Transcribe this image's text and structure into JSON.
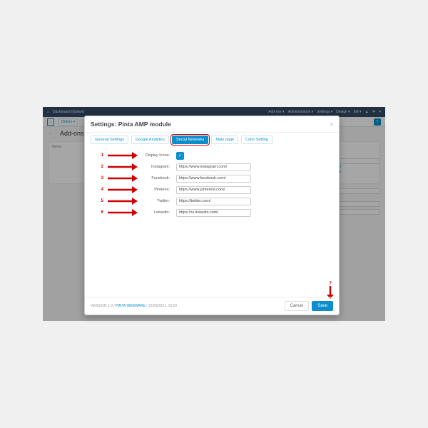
{
  "header": {
    "breadcrumb": "Dashboard (fastest)",
    "menu": {
      "addons": "Add-ons ▾",
      "admin": "Administration ▾",
      "settings": "Settings ▾",
      "design": "Design ▾",
      "lang": "EN ▾"
    }
  },
  "subheader": {
    "orders": "Orders ▾"
  },
  "page": {
    "back": "←",
    "title": "Add-ons"
  },
  "panel": {
    "name_col": "Name"
  },
  "sidebar": {
    "developers": "pers",
    "reload": "Reload",
    "odbase": "odbase"
  },
  "modal": {
    "title": "Settings: Pinta AMP module",
    "tabs": {
      "general": "General Settings",
      "analytics": "Google Analytics",
      "social": "Social Networks",
      "mainpage": "Main page",
      "color": "Color Setting"
    },
    "annotations": {
      "n1": "1",
      "n2": "2",
      "n3": "3",
      "n4": "4",
      "n5": "5",
      "n6": "6",
      "n7": "7"
    },
    "fields": {
      "display_icons": {
        "label": "Display Icons:",
        "checked": true
      },
      "instagram": {
        "label": "Instagram:",
        "value": "https://www.instagram.com/"
      },
      "facebook": {
        "label": "Facebook:",
        "value": "https://www.facebook.com/"
      },
      "pinterest": {
        "label": "Pinteres:",
        "value": "https://www.pinterest.com/"
      },
      "twitter": {
        "label": "Twitter:",
        "value": "https://twitter.com/"
      },
      "linkedin": {
        "label": "Linkedin:",
        "value": "https://ru.linkedin.com/"
      }
    },
    "footer": {
      "version_prefix": "VERSION 1.0 /",
      "vendor": "PINTA WEBWARE",
      "sep": "/",
      "date": "12/09/2021, 16:03",
      "cancel": "Cancel",
      "save": "Save"
    }
  }
}
